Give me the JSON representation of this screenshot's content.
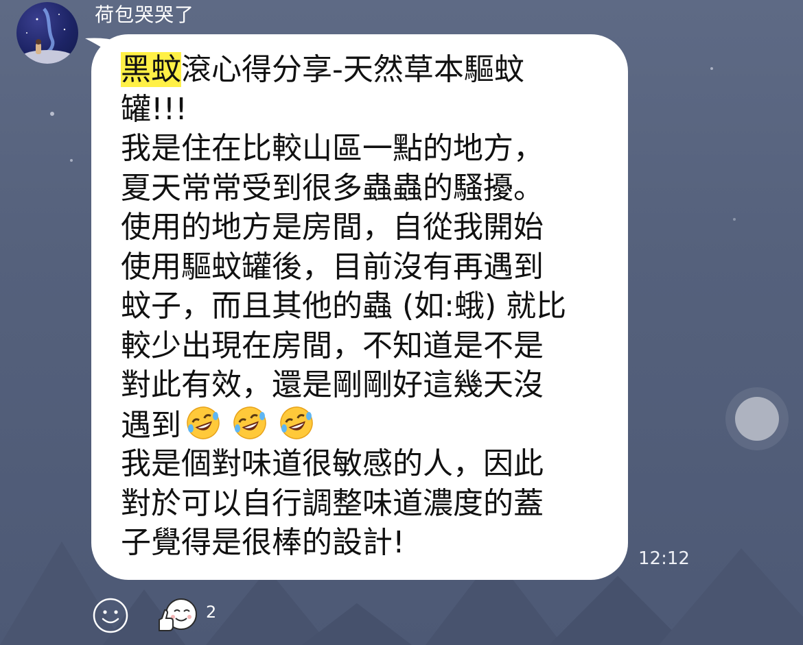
{
  "chat": {
    "sender_name": "荷包哭哭了",
    "timestamp": "12:12",
    "message": {
      "highlight": "黑蚊",
      "lines": [
        "滾心得分享-天然草本驅蚊",
        "罐!!!",
        "我是住在比較山區一點的地方，",
        "夏天常常受到很多蟲蟲的騷擾。",
        "使用的地方是房間，自從我開始",
        "使用驅蚊罐後，目前沒有再遇到",
        "蚊子，而且其他的蟲 (如:蛾) 就比",
        "較少出現在房間，不知道是不是",
        "對此有效，還是剛剛好這幾天沒",
        "遇到",
        "我是個對味道很敏感的人，因此",
        "對於可以自行調整味道濃度的蓋",
        "子覺得是很棒的設計!"
      ],
      "emoji_count": 3
    },
    "reaction": {
      "count": "2",
      "icon": "thumbs-up-face-icon"
    },
    "add_reaction_icon": "smiley-face-icon",
    "avatar_icon": "profile-avatar-icon"
  },
  "colors": {
    "background": "#55617c",
    "bubble": "#ffffff",
    "highlight": "#fff046",
    "text": "#111111"
  }
}
